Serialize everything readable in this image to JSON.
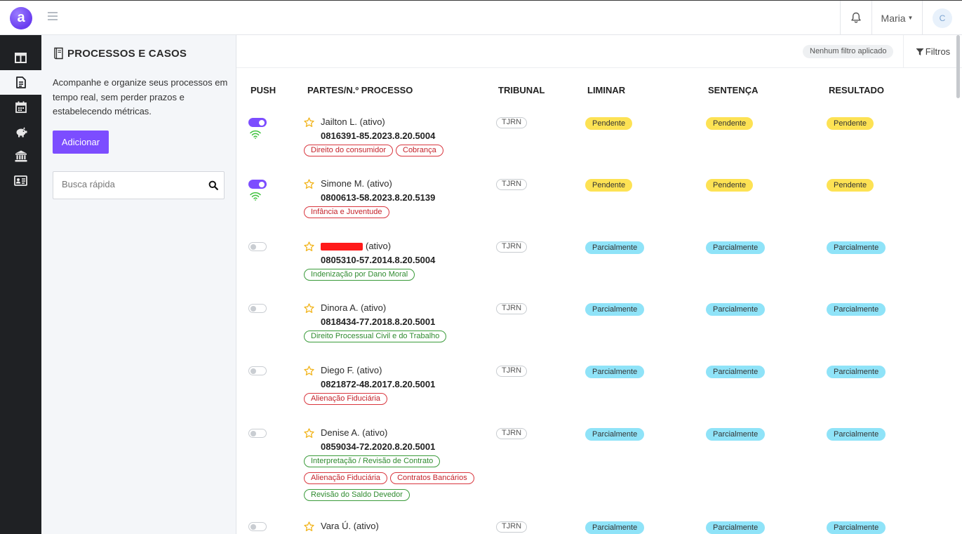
{
  "topbar": {
    "logo_letter": "a",
    "user_name": "Maria",
    "avatar_initial": "C"
  },
  "sidenav": {
    "items": [
      {
        "icon": "dashboard-columns-icon",
        "active": false
      },
      {
        "icon": "document-icon",
        "active": true
      },
      {
        "icon": "calendar-icon",
        "active": false
      },
      {
        "icon": "piggy-bank-icon",
        "active": false
      },
      {
        "icon": "bank-building-icon",
        "active": false
      },
      {
        "icon": "id-card-icon",
        "active": false
      }
    ]
  },
  "panel": {
    "title": "PROCESSOS E CASOS",
    "description": "Acompanhe e organize seus processos em tempo real, sem perder prazos e estabelecendo métricas.",
    "add_label": "Adicionar",
    "search_placeholder": "Busca rápida"
  },
  "filters": {
    "status": "Nenhum filtro aplicado",
    "button_label": "Filtros"
  },
  "table": {
    "headers": {
      "push": "PUSH",
      "parties": "PARTES/N.º PROCESSO",
      "court": "TRIBUNAL",
      "injunction": "LIMINAR",
      "sentence": "SENTENÇA",
      "result": "RESULTADO"
    },
    "rows": [
      {
        "push": true,
        "name": "Jailton L. (ativo)",
        "redacted": false,
        "number": "0816391-85.2023.8.20.5004",
        "tags": [
          {
            "label": "Direito do consumidor",
            "color": "red"
          },
          {
            "label": "Cobrança",
            "color": "red"
          }
        ],
        "court": "TJRN",
        "injunction": "Pendente",
        "sentence": "Pendente",
        "result": "Pendente"
      },
      {
        "push": true,
        "name": "Simone M. (ativo)",
        "redacted": false,
        "number": "0800613-58.2023.8.20.5139",
        "tags": [
          {
            "label": "Infância e Juventude",
            "color": "red"
          }
        ],
        "court": "TJRN",
        "injunction": "Pendente",
        "sentence": "Pendente",
        "result": "Pendente"
      },
      {
        "push": false,
        "name": "(ativo)",
        "redacted": true,
        "number": "0805310-57.2014.8.20.5004",
        "tags": [
          {
            "label": "Indenização por Dano Moral",
            "color": "green"
          }
        ],
        "court": "TJRN",
        "injunction": "Parcialmente",
        "sentence": "Parcialmente",
        "result": "Parcialmente"
      },
      {
        "push": false,
        "name": "Dinora A. (ativo)",
        "redacted": false,
        "number": "0818434-77.2018.8.20.5001",
        "tags": [
          {
            "label": "Direito Processual Civil e do Trabalho",
            "color": "green"
          }
        ],
        "court": "TJRN",
        "injunction": "Parcialmente",
        "sentence": "Parcialmente",
        "result": "Parcialmente"
      },
      {
        "push": false,
        "name": "Diego F. (ativo)",
        "redacted": false,
        "number": "0821872-48.2017.8.20.5001",
        "tags": [
          {
            "label": "Alienação Fiduciária",
            "color": "red"
          }
        ],
        "court": "TJRN",
        "injunction": "Parcialmente",
        "sentence": "Parcialmente",
        "result": "Parcialmente"
      },
      {
        "push": false,
        "name": "Denise A. (ativo)",
        "redacted": false,
        "number": "0859034-72.2020.8.20.5001",
        "tags": [
          {
            "label": "Interpretação / Revisão de Contrato",
            "color": "green"
          },
          {
            "label": "Alienação Fiduciária",
            "color": "red"
          },
          {
            "label": "Contratos Bancários",
            "color": "red"
          },
          {
            "label": "Revisão do Saldo Devedor",
            "color": "green"
          }
        ],
        "court": "TJRN",
        "injunction": "Parcialmente",
        "sentence": "Parcialmente",
        "result": "Parcialmente"
      },
      {
        "push": false,
        "name": "Vara Ú. (ativo)",
        "redacted": false,
        "number": "",
        "tags": [],
        "court": "TJRN",
        "injunction": "Parcialmente",
        "sentence": "Parcialmente",
        "result": "Parcialmente"
      }
    ]
  },
  "colors": {
    "accent": "#7c4dff",
    "pending_badge": "#fde254",
    "partial_badge": "#8fe3f8",
    "sidenav_bg": "#1f2124"
  }
}
